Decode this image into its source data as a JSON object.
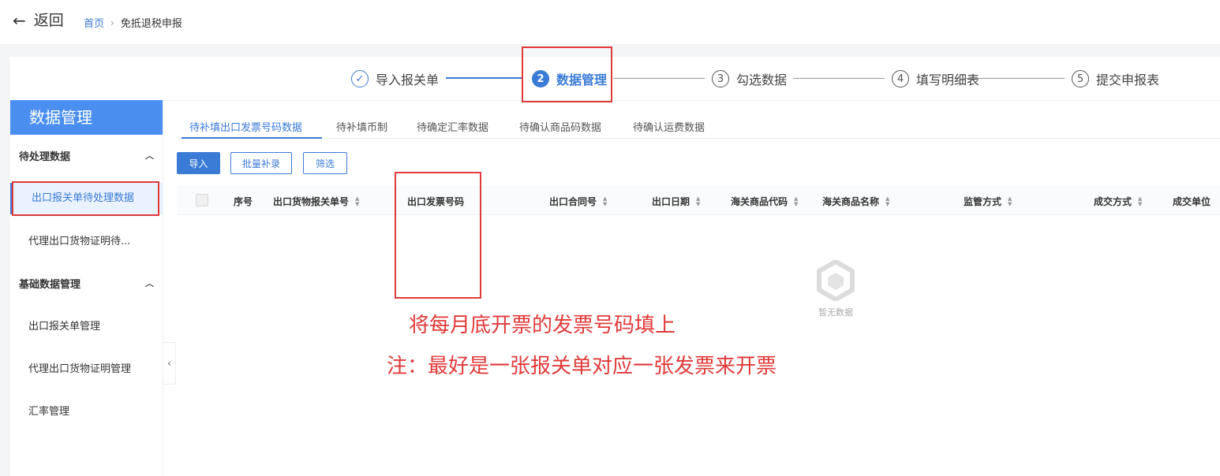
{
  "topbar": {
    "back_label": "返回",
    "breadcrumb": {
      "home": "首页",
      "current": "免抵退税申报"
    }
  },
  "steps": [
    {
      "num": "✓",
      "label": "导入报关单",
      "state": "done"
    },
    {
      "num": "2",
      "label": "数据管理",
      "state": "active"
    },
    {
      "num": "3",
      "label": "勾选数据",
      "state": "todo"
    },
    {
      "num": "4",
      "label": "填写明细表",
      "state": "todo"
    },
    {
      "num": "5",
      "label": "提交申报表",
      "state": "todo"
    }
  ],
  "sidebar": {
    "title": "数据管理",
    "groups": [
      {
        "label": "待处理数据",
        "items": [
          "出口报关单待处理数据",
          "代理出口货物证明待..."
        ]
      },
      {
        "label": "基础数据管理",
        "items": [
          "出口报关单管理",
          "代理出口货物证明管理",
          "汇率管理"
        ]
      }
    ]
  },
  "tabs": [
    "待补填出口发票号码数据",
    "待补填币制",
    "待确定汇率数据",
    "待确认商品码数据",
    "待确认运费数据"
  ],
  "toolbar": {
    "import": "导入",
    "batch": "批量补录",
    "filter": "筛选"
  },
  "table": {
    "columns": [
      "序号",
      "出口货物报关单号",
      "出口发票号码",
      "出口合同号",
      "出口日期",
      "海关商品代码",
      "海关商品名称",
      "监管方式",
      "成交方式",
      "成交单位"
    ],
    "empty_text": "暂无数据"
  },
  "annotations": {
    "line1": "将每月底开票的发票号码填上",
    "line2": "注：最好是一张报关单对应一张发票来开票"
  },
  "colors": {
    "accent": "#3a7bd5",
    "annotation": "#e03a3a",
    "sidebar_title": "#4a8ff0"
  }
}
